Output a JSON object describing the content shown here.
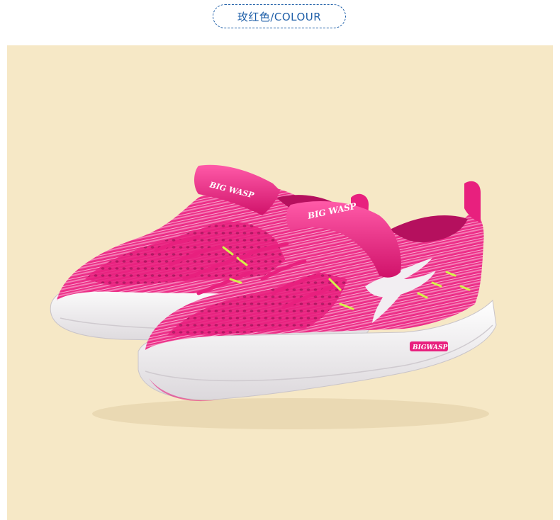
{
  "header": {
    "label": "玫红色/COLOUR"
  },
  "colors": {
    "accent": "#1f5fa8",
    "background": "#f6e8c6",
    "shoe_pink": "#e8207e",
    "sole_white": "#f4f1f4",
    "lace_yellow": "#d6f24a"
  },
  "product": {
    "brand_strap_left": "BIG WASP",
    "brand_strap_right": "BIG WASP",
    "brand_sole": "BIGWASP"
  }
}
